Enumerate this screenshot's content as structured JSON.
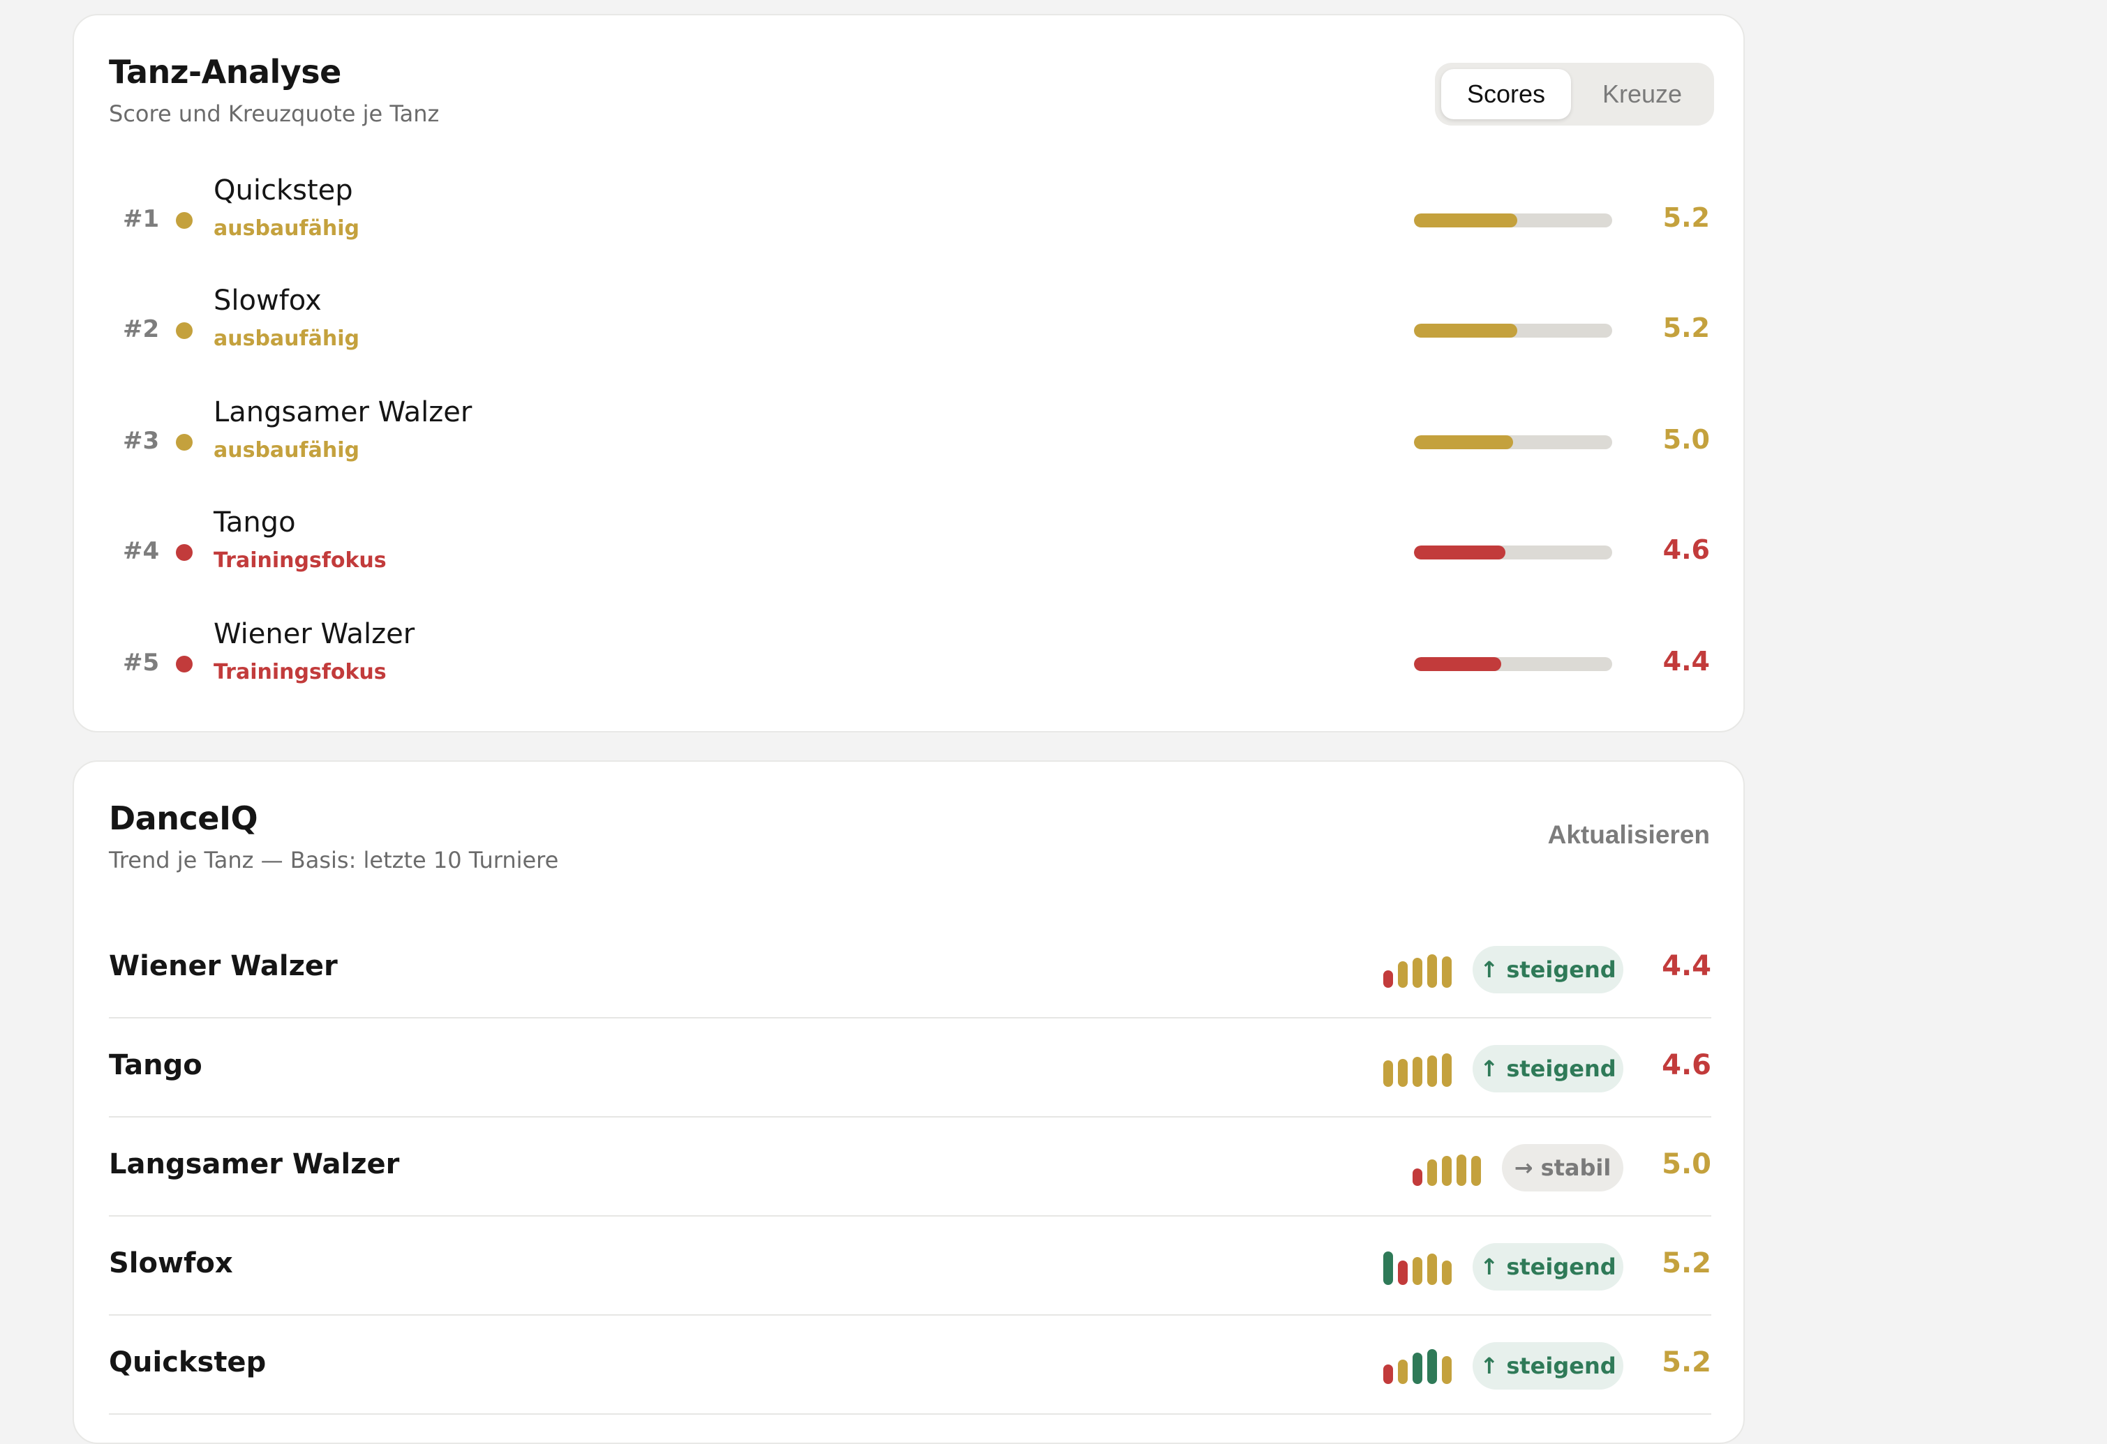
{
  "colors": {
    "gold": "#c4a13d",
    "red": "#c23b3b",
    "green": "#2f7a58",
    "track": "#dcdad5"
  },
  "analyse": {
    "title": "Tanz-Analyse",
    "subtitle": "Score und Kreuzquote je Tanz",
    "tabs": {
      "active": "Scores",
      "inactive": "Kreuze"
    },
    "score_max": 10,
    "rows": [
      {
        "rank": "#1",
        "name": "Quickstep",
        "status": "ausbaufähig",
        "score": "5.2",
        "value": 5.2,
        "color": "gold"
      },
      {
        "rank": "#2",
        "name": "Slowfox",
        "status": "ausbaufähig",
        "score": "5.2",
        "value": 5.2,
        "color": "gold"
      },
      {
        "rank": "#3",
        "name": "Langsamer Walzer",
        "status": "ausbaufähig",
        "score": "5.0",
        "value": 5.0,
        "color": "gold"
      },
      {
        "rank": "#4",
        "name": "Tango",
        "status": "Trainingsfokus",
        "score": "4.6",
        "value": 4.6,
        "color": "red"
      },
      {
        "rank": "#5",
        "name": "Wiener Walzer",
        "status": "Trainingsfokus",
        "score": "4.4",
        "value": 4.4,
        "color": "red"
      }
    ]
  },
  "danceiq": {
    "title": "DanceIQ",
    "subtitle": "Trend je Tanz — Basis: letzte 10 Turniere",
    "update_label": "Aktualisieren",
    "rows": [
      {
        "name": "Wiener Walzer",
        "trend": "↑ steigend",
        "trend_type": "up",
        "score": "4.4",
        "score_color": "red",
        "spark": [
          {
            "h": 0.5,
            "c": "red"
          },
          {
            "h": 0.75,
            "c": "gold"
          },
          {
            "h": 0.85,
            "c": "gold"
          },
          {
            "h": 0.95,
            "c": "gold"
          },
          {
            "h": 0.9,
            "c": "gold"
          }
        ]
      },
      {
        "name": "Tango",
        "trend": "↑ steigend",
        "trend_type": "up",
        "score": "4.6",
        "score_color": "red",
        "spark": [
          {
            "h": 0.75,
            "c": "gold"
          },
          {
            "h": 0.8,
            "c": "gold"
          },
          {
            "h": 0.85,
            "c": "gold"
          },
          {
            "h": 0.9,
            "c": "gold"
          },
          {
            "h": 0.95,
            "c": "gold"
          }
        ]
      },
      {
        "name": "Langsamer Walzer",
        "trend": "→ stabil",
        "trend_type": "flat",
        "score": "5.0",
        "score_color": "gold",
        "spark": [
          {
            "h": 0.5,
            "c": "red"
          },
          {
            "h": 0.75,
            "c": "gold"
          },
          {
            "h": 0.85,
            "c": "gold"
          },
          {
            "h": 0.9,
            "c": "gold"
          },
          {
            "h": 0.85,
            "c": "gold"
          }
        ]
      },
      {
        "name": "Slowfox",
        "trend": "↑ steigend",
        "trend_type": "up",
        "score": "5.2",
        "score_color": "gold",
        "spark": [
          {
            "h": 0.95,
            "c": "green"
          },
          {
            "h": 0.7,
            "c": "red"
          },
          {
            "h": 0.8,
            "c": "gold"
          },
          {
            "h": 0.9,
            "c": "gold"
          },
          {
            "h": 0.7,
            "c": "gold"
          }
        ]
      },
      {
        "name": "Quickstep",
        "trend": "↑ steigend",
        "trend_type": "up",
        "score": "5.2",
        "score_color": "gold",
        "spark": [
          {
            "h": 0.55,
            "c": "red"
          },
          {
            "h": 0.7,
            "c": "gold"
          },
          {
            "h": 0.9,
            "c": "green"
          },
          {
            "h": 1.0,
            "c": "green"
          },
          {
            "h": 0.8,
            "c": "gold"
          }
        ]
      }
    ]
  }
}
